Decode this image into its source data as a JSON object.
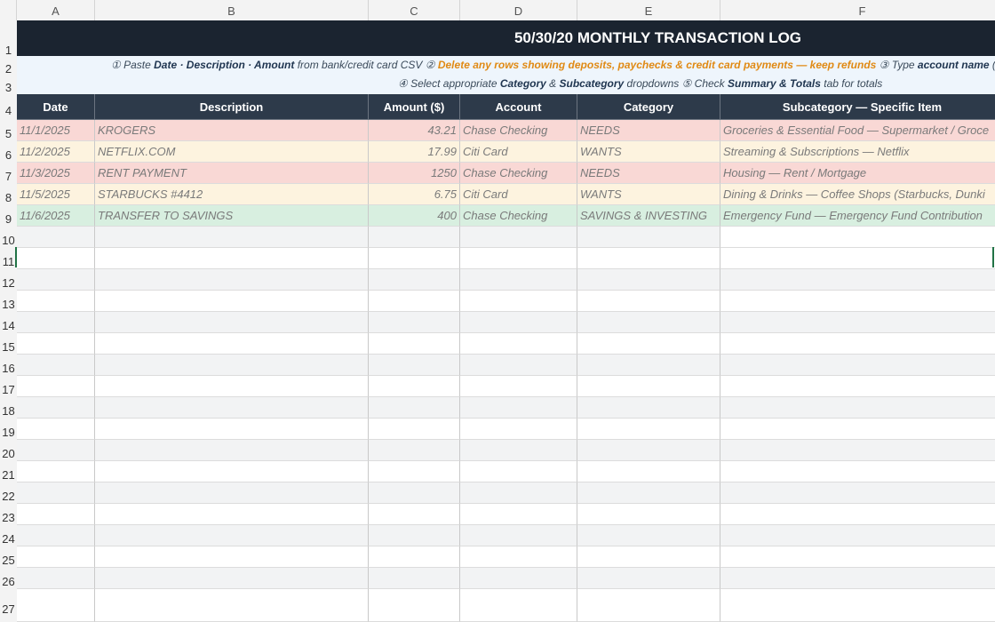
{
  "columns": [
    "A",
    "B",
    "C",
    "D",
    "E",
    "F"
  ],
  "title": "50/30/20  MONTHLY TRANSACTION LOG",
  "instructions": {
    "line1": [
      {
        "t": "① Paste ",
        "s": "n"
      },
      {
        "t": "Date · Description · Amount",
        "s": "b"
      },
      {
        "t": " from bank/credit card CSV   ② ",
        "s": "n"
      },
      {
        "t": "Delete any rows showing deposits, paychecks & credit card payments — keep refunds",
        "s": "w"
      },
      {
        "t": "   ③ Type ",
        "s": "n"
      },
      {
        "t": "account name",
        "s": "b"
      },
      {
        "t": " (e.",
        "s": "n"
      }
    ],
    "line2": [
      {
        "t": "④ Select appropriate ",
        "s": "n"
      },
      {
        "t": "Category",
        "s": "b"
      },
      {
        "t": " & ",
        "s": "n"
      },
      {
        "t": "Subcategory",
        "s": "b"
      },
      {
        "t": " dropdowns   ⑤ Check ",
        "s": "n"
      },
      {
        "t": "Summary & Totals",
        "s": "b"
      },
      {
        "t": " tab for totals",
        "s": "n"
      }
    ]
  },
  "headers": [
    "Date",
    "Description",
    "Amount ($)",
    "Account",
    "Category",
    "Subcategory — Specific Item"
  ],
  "transactions": [
    {
      "date": "11/1/2025",
      "description": "KROGERS",
      "amount": "43.21",
      "account": "Chase Checking",
      "category": "NEEDS",
      "subcategory": "Groceries & Essential Food — Supermarket / Groce",
      "type": "needs"
    },
    {
      "date": "11/2/2025",
      "description": "NETFLIX.COM",
      "amount": "17.99",
      "account": "Citi Card",
      "category": "WANTS",
      "subcategory": "Streaming & Subscriptions — Netflix",
      "type": "wants"
    },
    {
      "date": "11/3/2025",
      "description": "RENT PAYMENT",
      "amount": "1250",
      "account": "Chase Checking",
      "category": "NEEDS",
      "subcategory": "Housing — Rent / Mortgage",
      "type": "needs"
    },
    {
      "date": "11/5/2025",
      "description": "STARBUCKS #4412",
      "amount": "6.75",
      "account": "Citi Card",
      "category": "WANTS",
      "subcategory": "Dining & Drinks — Coffee Shops (Starbucks, Dunki",
      "type": "wants"
    },
    {
      "date": "11/6/2025",
      "description": "TRANSFER TO SAVINGS",
      "amount": "400",
      "account": "Chase Checking",
      "category": "SAVINGS & INVESTING",
      "subcategory": "Emergency Fund — Emergency Fund Contribution",
      "type": "save"
    }
  ],
  "row_numbers": [
    "1",
    "2",
    "3",
    "4",
    "5",
    "6",
    "7",
    "8",
    "9",
    "10",
    "11",
    "12",
    "13",
    "14",
    "15",
    "16",
    "17",
    "18",
    "19",
    "20",
    "21",
    "22",
    "23",
    "24",
    "25",
    "26",
    "27"
  ],
  "colors": {
    "title_bg": "#1b2430",
    "header_bg": "#2d3a4a",
    "needs": "#f9d8d5",
    "wants": "#fdf3df",
    "savings": "#d8efe0",
    "warning_text": "#e08a14"
  }
}
